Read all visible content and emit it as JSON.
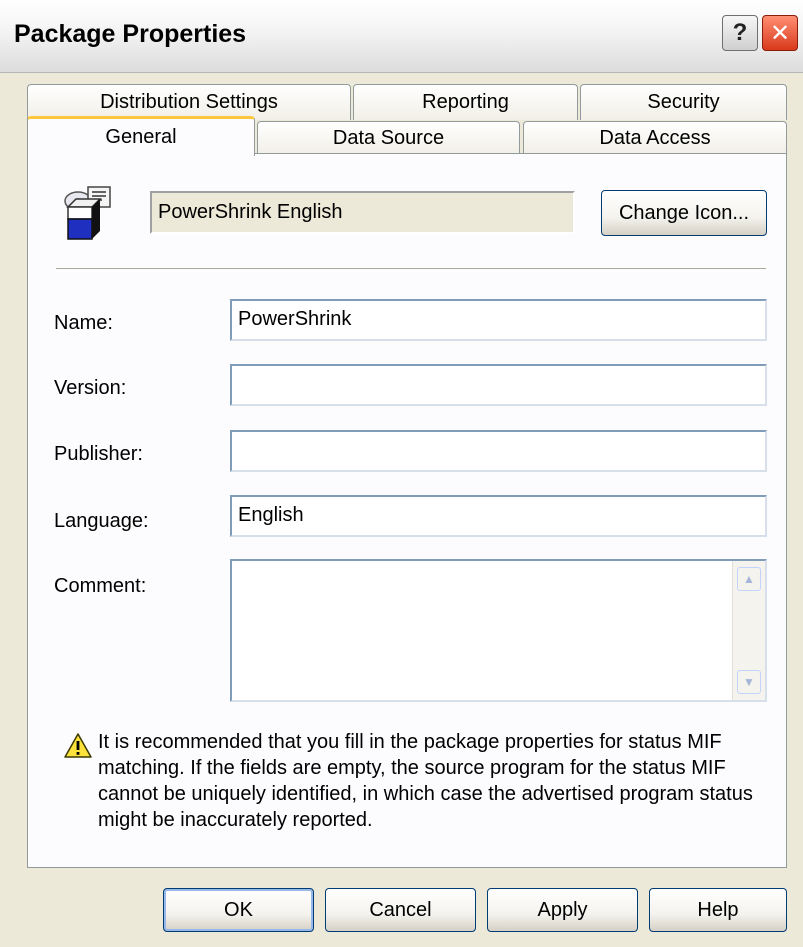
{
  "window": {
    "title": "Package Properties",
    "help_glyph": "?",
    "close_glyph": "✕"
  },
  "tabs": {
    "row_back": [
      {
        "label": "Distribution Settings"
      },
      {
        "label": "Reporting"
      },
      {
        "label": "Security"
      }
    ],
    "row_front": [
      {
        "label": "General",
        "active": true
      },
      {
        "label": "Data Source"
      },
      {
        "label": "Data Access"
      }
    ]
  },
  "general": {
    "package_icon": "package-icon",
    "display_name": "PowerShrink  English",
    "change_icon_label": "Change Icon...",
    "fields": {
      "name": {
        "label": "Name:",
        "value": "PowerShrink"
      },
      "version": {
        "label": "Version:",
        "value": ""
      },
      "publisher": {
        "label": "Publisher:",
        "value": ""
      },
      "language": {
        "label": "Language:",
        "value": "English"
      },
      "comment": {
        "label": "Comment:",
        "value": ""
      }
    },
    "warning_icon": "warning-icon",
    "warning_text": "It is recommended that you fill in the package properties for status MIF matching. If the fields are empty, the source program for the status MIF cannot be uniquely identified, in which case the advertised program status might be inaccurately reported."
  },
  "buttons": {
    "ok": "OK",
    "cancel": "Cancel",
    "apply": "Apply",
    "help": "Help"
  }
}
